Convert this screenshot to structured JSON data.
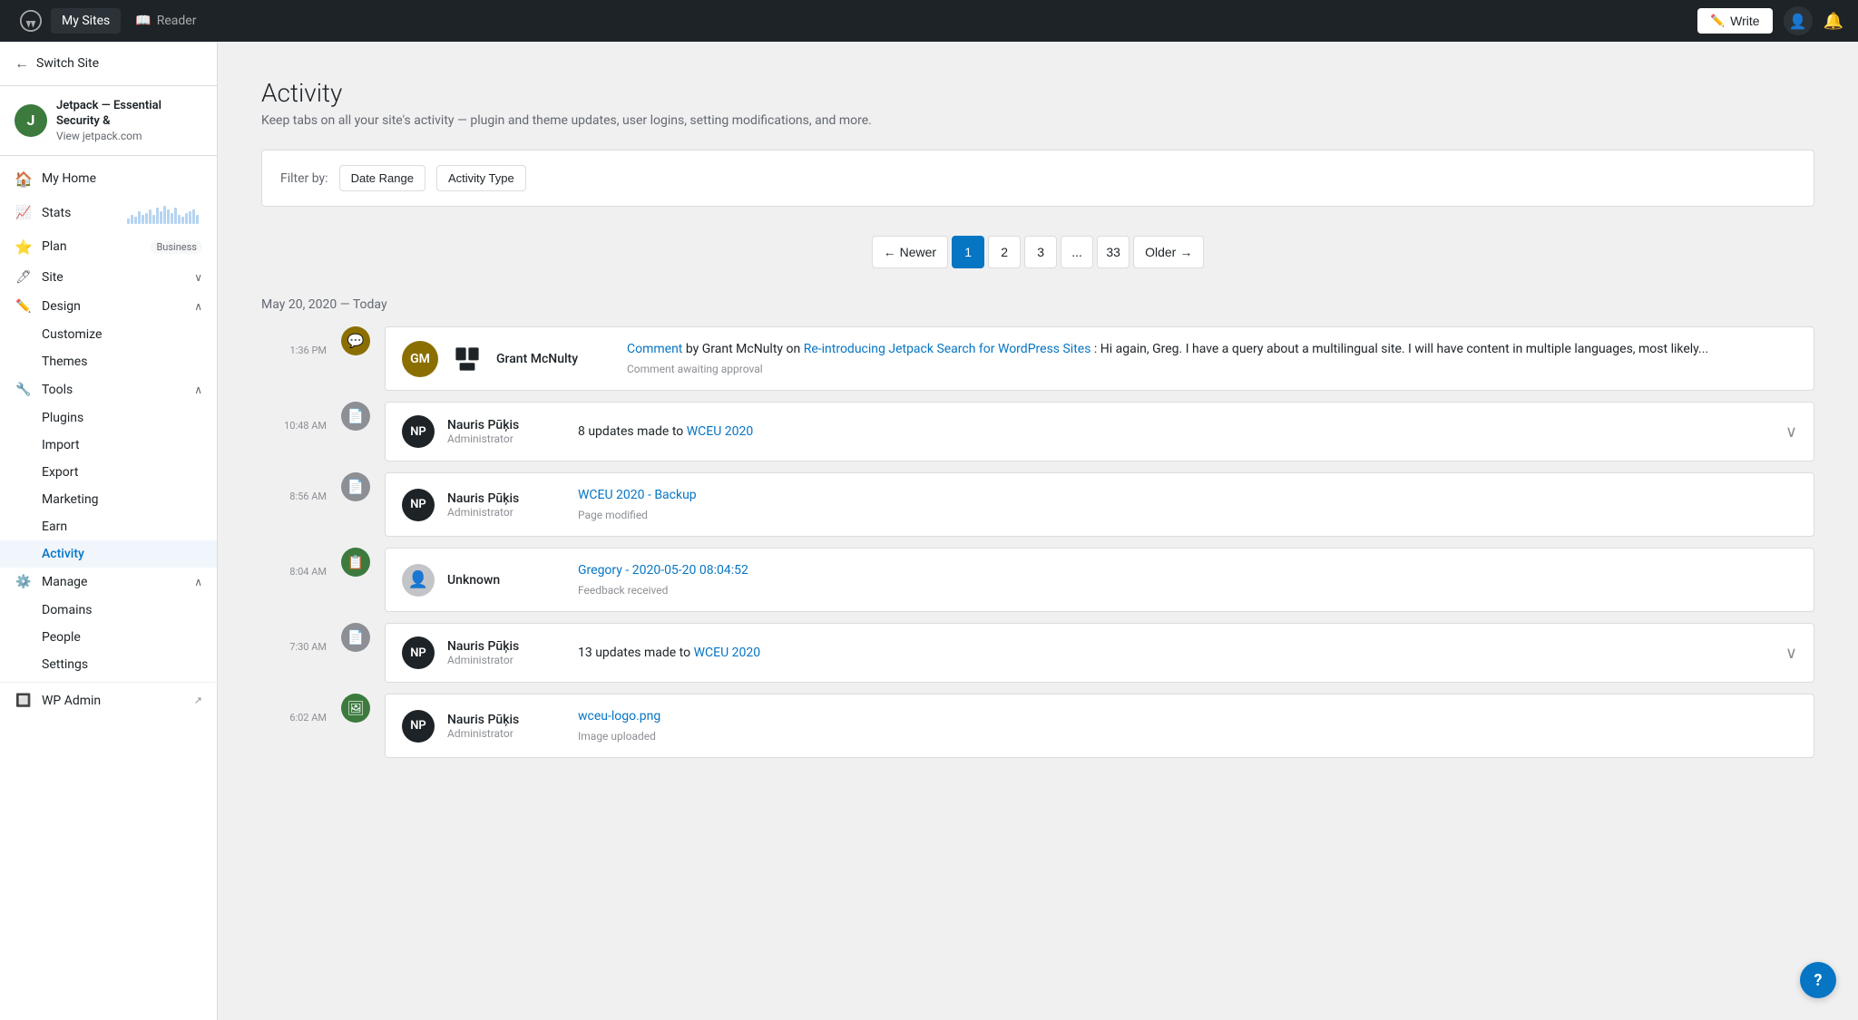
{
  "topnav": {
    "my_sites_label": "My Sites",
    "reader_label": "Reader",
    "write_label": "Write"
  },
  "sidebar": {
    "switch_site_label": "Switch Site",
    "site": {
      "name": "Jetpack — Essential Security &",
      "name2": "View jetpack.com",
      "icon_letter": "J"
    },
    "nav_items": [
      {
        "id": "my-home",
        "label": "My Home",
        "icon": "🏠",
        "has_chevron": false
      },
      {
        "id": "stats",
        "label": "Stats",
        "icon": "📊",
        "has_chevron": false,
        "has_chart": true
      },
      {
        "id": "plan",
        "label": "Plan",
        "icon": "⭐",
        "has_chevron": false,
        "badge": "Business"
      },
      {
        "id": "site",
        "label": "Site",
        "icon": "📋",
        "has_chevron": true,
        "expanded": false
      },
      {
        "id": "design",
        "label": "Design",
        "icon": "✏️",
        "has_chevron": true,
        "expanded": true
      },
      {
        "id": "customize",
        "label": "Customize",
        "sub": true
      },
      {
        "id": "themes",
        "label": "Themes",
        "sub": true
      },
      {
        "id": "tools",
        "label": "Tools",
        "icon": "🔧",
        "has_chevron": true,
        "expanded": true
      },
      {
        "id": "plugins",
        "label": "Plugins",
        "sub": true
      },
      {
        "id": "import",
        "label": "Import",
        "sub": true
      },
      {
        "id": "export",
        "label": "Export",
        "sub": true
      },
      {
        "id": "marketing",
        "label": "Marketing",
        "sub": true
      },
      {
        "id": "earn",
        "label": "Earn",
        "sub": true
      },
      {
        "id": "activity",
        "label": "Activity",
        "sub": true,
        "active": true
      },
      {
        "id": "manage",
        "label": "Manage",
        "icon": "⚙️",
        "has_chevron": true,
        "expanded": true
      },
      {
        "id": "domains",
        "label": "Domains",
        "sub": true
      },
      {
        "id": "people",
        "label": "People",
        "sub": true
      },
      {
        "id": "settings",
        "label": "Settings",
        "sub": true
      },
      {
        "id": "wp-admin",
        "label": "WP Admin",
        "icon": "🔲",
        "has_external": true
      }
    ]
  },
  "page": {
    "title": "Activity",
    "subtitle": "Keep tabs on all your site's activity — plugin and theme updates, user logins, setting modifications, and more."
  },
  "filters": {
    "label": "Filter by:",
    "date_range": "Date Range",
    "activity_type": "Activity Type"
  },
  "pagination": {
    "newer": "← Newer",
    "older": "Older →",
    "pages": [
      "1",
      "2",
      "3",
      "...",
      "33"
    ],
    "active_page": "1"
  },
  "date_heading": "May 20, 2020 — Today",
  "activities": [
    {
      "time": "1:36 PM",
      "icon_color": "#8a6f00",
      "icon_type": "comment",
      "user_name": "Grant McNulty",
      "user_role": "",
      "is_grant": true,
      "content_prefix": "Comment",
      "content_link": "Comment",
      "content_link_url": "#",
      "content_text": " by Grant McNulty on ",
      "content_link2": "Re-introducing Jetpack Search for WordPress Sites",
      "content_link2_url": "#",
      "content_suffix": ": Hi again, Greg. I have a query about a multilingual site. I will have content in multiple languages, most likely...",
      "meta": "Comment awaiting approval",
      "expandable": false
    },
    {
      "time": "10:48 AM",
      "icon_color": "#8c8f94",
      "icon_type": "page",
      "user_name": "Nauris Pūķis",
      "user_role": "Administrator",
      "content_updates": "8 updates made to ",
      "content_link": "WCEU 2020",
      "content_link_url": "#",
      "meta": "",
      "expandable": true
    },
    {
      "time": "8:56 AM",
      "icon_color": "#8c8f94",
      "icon_type": "page",
      "user_name": "Nauris Pūķis",
      "user_role": "Administrator",
      "content_link": "WCEU 2020 - Backup",
      "content_link_url": "#",
      "meta": "Page modified",
      "expandable": false
    },
    {
      "time": "8:04 AM",
      "icon_color": "#3c7a3e",
      "icon_type": "feedback",
      "user_name": "Unknown",
      "user_role": "",
      "is_unknown": true,
      "content_link": "Gregory - 2020-05-20 08:04:52",
      "content_link_url": "#",
      "meta": "Feedback received",
      "expandable": false
    },
    {
      "time": "7:30 AM",
      "icon_color": "#8c8f94",
      "icon_type": "page",
      "user_name": "Nauris Pūķis",
      "user_role": "Administrator",
      "content_updates": "13 updates made to ",
      "content_link": "WCEU 2020",
      "content_link_url": "#",
      "meta": "",
      "expandable": true
    },
    {
      "time": "6:02 AM",
      "icon_color": "#3c7a3e",
      "icon_type": "image",
      "user_name": "Nauris Pūķis",
      "user_role": "Administrator",
      "content_link": "wceu-logo.png",
      "content_link_url": "#",
      "meta": "Image uploaded",
      "expandable": false
    }
  ]
}
